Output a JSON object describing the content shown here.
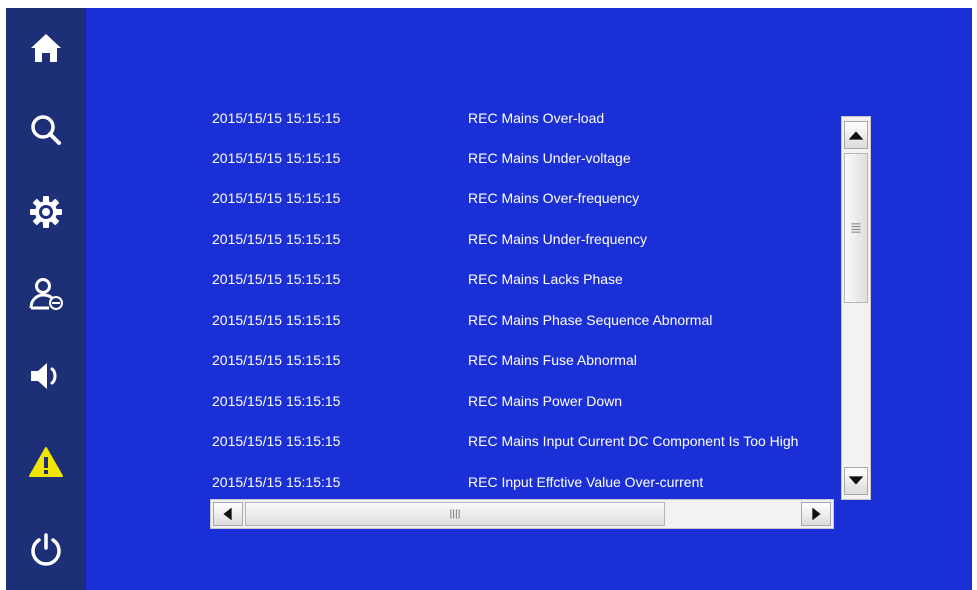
{
  "sidebar": {
    "items": [
      {
        "icon": "home-icon",
        "color": "#ffffff"
      },
      {
        "icon": "search-icon",
        "color": "#ffffff"
      },
      {
        "icon": "gear-icon",
        "color": "#ffffff"
      },
      {
        "icon": "user-icon",
        "color": "#ffffff"
      },
      {
        "icon": "speaker-icon",
        "color": "#ffffff"
      },
      {
        "icon": "warning-icon",
        "color": "#f2e600"
      },
      {
        "icon": "power-icon",
        "color": "#ffffff"
      }
    ],
    "background": "#1d2f76"
  },
  "main": {
    "background": "#1b2fd6",
    "log": [
      {
        "time": "2015/15/15 15:15:15",
        "message": "REC Mains Over-load"
      },
      {
        "time": "2015/15/15 15:15:15",
        "message": "REC Mains Under-voltage"
      },
      {
        "time": "2015/15/15 15:15:15",
        "message": "REC Mains Over-frequency"
      },
      {
        "time": "2015/15/15 15:15:15",
        "message": "REC Mains Under-frequency"
      },
      {
        "time": "2015/15/15 15:15:15",
        "message": "REC Mains Lacks Phase"
      },
      {
        "time": "2015/15/15 15:15:15",
        "message": "REC Mains Phase Sequence Abnormal"
      },
      {
        "time": "2015/15/15 15:15:15",
        "message": "REC Mains Fuse Abnormal"
      },
      {
        "time": "2015/15/15 15:15:15",
        "message": "REC Mains Power Down"
      },
      {
        "time": "2015/15/15 15:15:15",
        "message": "REC Mains Input Current DC Component Is Too High"
      },
      {
        "time": "2015/15/15 15:15:15",
        "message": "REC Input Effctive Value Over-current"
      }
    ]
  }
}
